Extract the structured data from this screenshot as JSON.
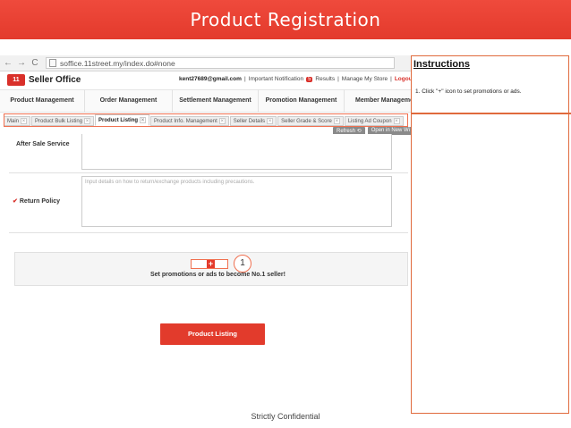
{
  "slide": {
    "title": "Product Registration",
    "footer": "Strictly Confidential"
  },
  "browser": {
    "back": "←",
    "forward": "→",
    "reload": "C",
    "url": "soffice.11street.my/index.do#none"
  },
  "seller_header": {
    "logo_badge": "11",
    "logo_text": "Seller Office",
    "email": "kent27689@gmail.com",
    "notification": "Important Notification",
    "notification_count": "5",
    "results": "Results",
    "manage_store": "Manage My Store",
    "logout": "Logout"
  },
  "main_menu": [
    "Product Management",
    "Order Management",
    "Settlement Management",
    "Promotion Management",
    "Member Manageme"
  ],
  "tabs": [
    "Main",
    "Product Bulk Listing",
    "Product Listing",
    "Product Info. Management",
    "Seller Details",
    "Seller Grade & Score",
    "Listing Ad Coupon"
  ],
  "tab_close": "×",
  "buttons": {
    "refresh": "Refresh ⟲",
    "open_new": "Open in New Wi"
  },
  "form": {
    "after_sale_label": "After Sale Service",
    "return_policy_label": "Return Policy",
    "return_policy_placeholder": "Input details on how to return/exchange products including precautions.",
    "check_mark": "✔"
  },
  "promo": {
    "plus": "+",
    "text": "Set promotions or ads to become No.1 seller!",
    "step": "1"
  },
  "product_listing_button": "Product Listing",
  "instructions": {
    "title": "Instructions",
    "step1": "1. Click \"+\" icon to set promotions or ads."
  }
}
